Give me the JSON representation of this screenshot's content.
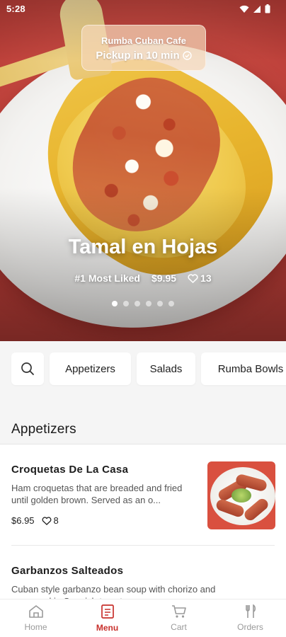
{
  "status_bar": {
    "time": "5:28"
  },
  "hero": {
    "restaurant": "Rumba Cuban Cafe",
    "pickup": "Pickup in 10 min",
    "dish_title": "Tamal en Hojas",
    "rank": "#1 Most Liked",
    "price": "$9.95",
    "likes": "13",
    "carousel_pages": 6,
    "carousel_active": 0
  },
  "categories": [
    "Appetizers",
    "Salads",
    "Rumba Bowls"
  ],
  "section": {
    "title": "Appetizers"
  },
  "items": [
    {
      "title": "Croquetas De La Casa",
      "description": "Ham croquetas that are breaded and fried until golden brown. Served as an o...",
      "price": "$6.95",
      "likes": "8"
    },
    {
      "title": "Garbanzos Salteados",
      "description": "Cuban style garbanzo bean soup with chorizo and seasoned in Spanish tomato sauce",
      "price": "",
      "likes": ""
    }
  ],
  "nav": [
    {
      "label": "Home",
      "icon": "home-icon",
      "active": false
    },
    {
      "label": "Menu",
      "icon": "menu-icon",
      "active": true
    },
    {
      "label": "Cart",
      "icon": "cart-icon",
      "active": false
    },
    {
      "label": "Orders",
      "icon": "orders-icon",
      "active": false
    }
  ],
  "colors": {
    "accent": "#c8302c",
    "background": "#f5f5f5"
  }
}
